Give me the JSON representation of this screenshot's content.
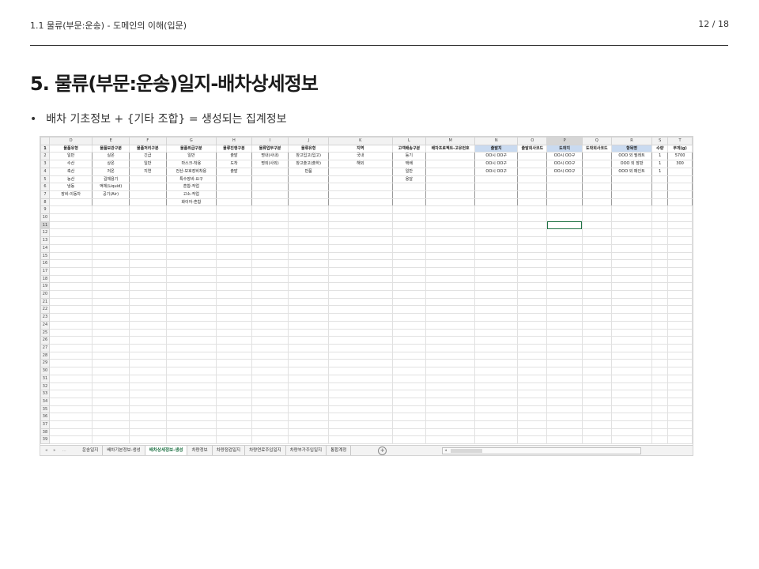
{
  "header": {
    "breadcrumb": "1.1 물류(부문:운송) - 도메인의 이해(입문)",
    "page_number": "12 / 18"
  },
  "title": "5. 물류(부문:운송)일지-배차상세정보",
  "bullet": {
    "marker": "•",
    "text": "배차 기초정보 + {기타 조합} = 생성되는 집계정보"
  },
  "spreadsheet": {
    "columns": [
      "D",
      "E",
      "F",
      "G",
      "H",
      "I",
      "J",
      "K",
      "L",
      "M",
      "N",
      "O",
      "P",
      "Q",
      "R",
      "S",
      "T"
    ],
    "selected_column": "P",
    "selected_row": 11,
    "header_row": [
      "물품유형",
      "물품보관구분",
      "물품처리구분",
      "물품취급구분",
      "물류진행구분",
      "물류업무구분",
      "물류유형",
      "지역",
      "고객배송구분",
      "배차프로젝트-고유번호",
      "출발지",
      "출발회사코드",
      "도착지",
      "도착회사코드",
      "항목명",
      "수량",
      "무게(g)"
    ],
    "blue_header_columns": [
      "N",
      "P",
      "R"
    ],
    "rows": [
      [
        "일반",
        "실온",
        "긴급",
        "일반",
        "출발",
        "명내(사내)",
        "창고입고(입고)",
        "국내",
        "등기",
        "",
        "OO시 OO구",
        "",
        "OO시 OO구",
        "",
        "OOO 외 필레트",
        "1",
        "5700"
      ],
      [
        "수산",
        "상온",
        "일반",
        "마스크-착용",
        "도착",
        "명외(사외)",
        "창고출고(출하)",
        "해외",
        "택배",
        "",
        "OO시 OO구",
        "",
        "OO시 OO구",
        "",
        "OOO 외 장판",
        "1",
        "300"
      ],
      [
        "축산",
        "저온",
        "지연",
        "전산-보호장비착용",
        "출발",
        "",
        "반품",
        "",
        "일반",
        "",
        "OO시 OO구",
        "",
        "OO시 OO구",
        "",
        "OOO 외 페인트",
        "1",
        ""
      ],
      [
        "농산",
        "길체용기",
        "",
        "특수장비-요구",
        "",
        "",
        "",
        "",
        "용달",
        "",
        "",
        "",
        "",
        "",
        "",
        "",
        ""
      ],
      [
        "냉동",
        "액체(Liquid)",
        "",
        "혼합-작업",
        "",
        "",
        "",
        "",
        "",
        "",
        "",
        "",
        "",
        "",
        "",
        "",
        ""
      ],
      [
        "장비-이동차",
        "공기(Air)",
        "",
        "고소-작업",
        "",
        "",
        "",
        "",
        "",
        "",
        "",
        "",
        "",
        "",
        "",
        "",
        ""
      ],
      [
        "",
        "",
        "",
        "화이어-혼합",
        "",
        "",
        "",
        "",
        "",
        "",
        "",
        "",
        "",
        "",
        "",
        "",
        ""
      ]
    ],
    "total_rows": 39,
    "tabs": [
      "운송일지",
      "배차기본정보-생성",
      "배차상세정보-생성",
      "차량정보",
      "차량점검일지",
      "차량연료주입일지",
      "차량부가주입일지",
      "통합계정"
    ],
    "active_tab": "배차상세정보-생성",
    "tab_nav": [
      "◂",
      "▸",
      "..."
    ],
    "add_sheet_icon": "+",
    "accent_color": "#217346",
    "header_blue": "#c9daf0"
  }
}
